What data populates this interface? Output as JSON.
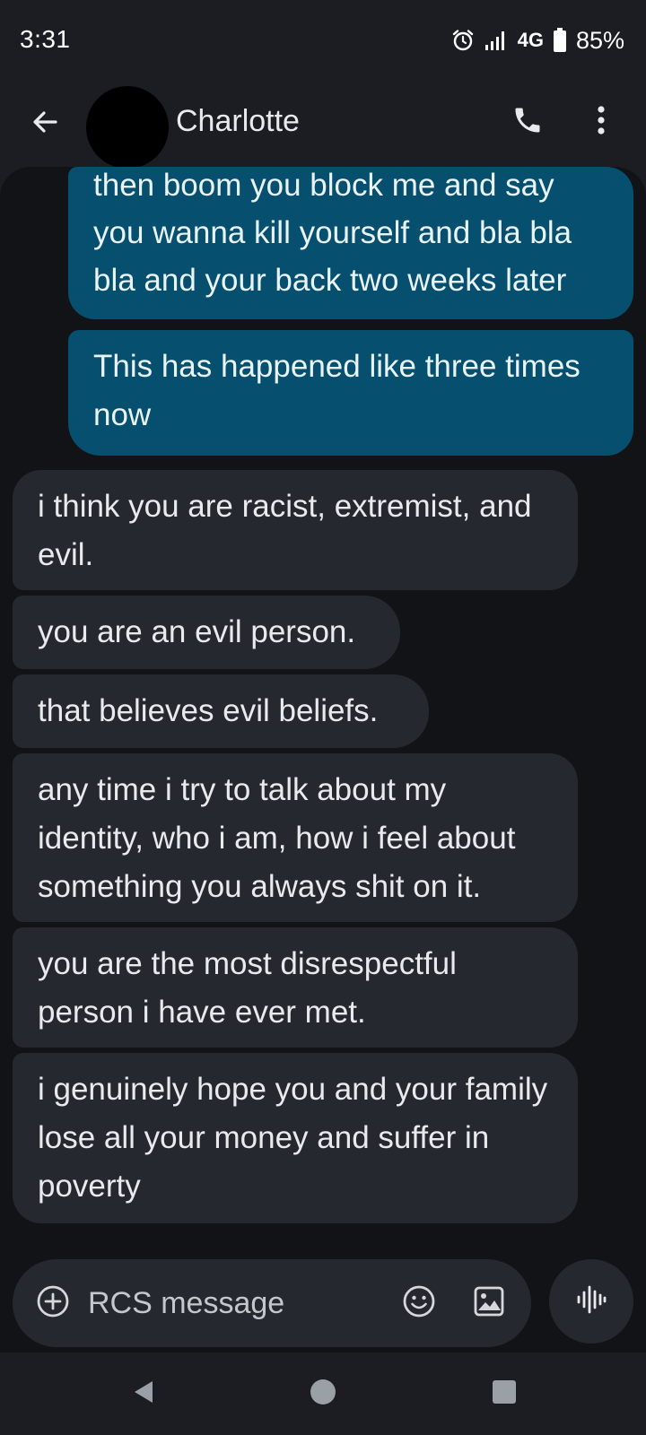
{
  "status_bar": {
    "time": "3:31",
    "network": "4G",
    "battery": "85%",
    "icons": [
      "alarm-icon",
      "signal-icon",
      "battery-icon"
    ]
  },
  "header": {
    "back_icon": "arrow-back-icon",
    "contact_name": "Charlotte",
    "call_icon": "phone-icon",
    "more_icon": "more-vert-icon"
  },
  "messages": [
    {
      "direction": "outgoing",
      "text": "then boom you block me and say you wanna kill yourself and bla bla bla and your back two weeks later"
    },
    {
      "direction": "outgoing",
      "text": "This has happened like three times now"
    },
    {
      "direction": "incoming",
      "text": "i think you are racist, extremist, and evil."
    },
    {
      "direction": "incoming",
      "text": "you are an evil person."
    },
    {
      "direction": "incoming",
      "text": "that believes evil beliefs."
    },
    {
      "direction": "incoming",
      "text": "any time i try to talk about my identity, who i am, how i feel about something you always shit on it."
    },
    {
      "direction": "incoming",
      "text": "you are the most disrespectful person i have ever met."
    },
    {
      "direction": "incoming",
      "text": "i genuinely hope you and your family lose all your money and suffer in poverty"
    }
  ],
  "composer": {
    "placeholder": "RCS message",
    "icons": [
      "add-circle-icon",
      "emoji-icon",
      "gallery-icon",
      "voice-message-icon"
    ]
  },
  "colors": {
    "background": "#111317",
    "header": "#1b1d22",
    "outgoing_bubble": "#064f6e",
    "incoming_bubble": "#25282e"
  }
}
